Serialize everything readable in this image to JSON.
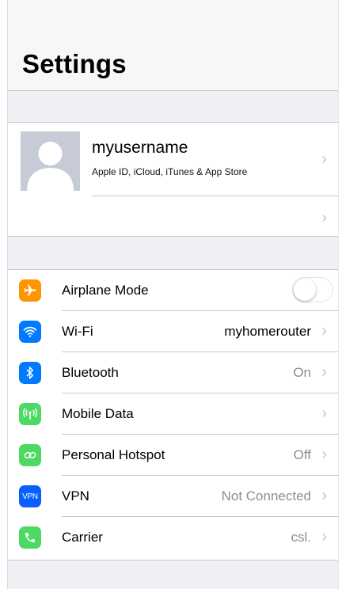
{
  "header": {
    "title": "Settings"
  },
  "profile": {
    "name": "myusername",
    "subtitle": "Apple ID, iCloud, iTunes & App Store"
  },
  "settings": [
    {
      "label": "Airplane Mode",
      "icon": "airplane-icon",
      "color": "#ff9500",
      "value": "",
      "toggle": false
    },
    {
      "label": "Wi-Fi",
      "icon": "wifi-icon",
      "color": "#007aff",
      "value": "myhomerouter"
    },
    {
      "label": "Bluetooth",
      "icon": "bluetooth-icon",
      "color": "#007aff",
      "value": "On"
    },
    {
      "label": "Mobile Data",
      "icon": "antenna-icon",
      "color": "#4cd964",
      "value": ""
    },
    {
      "label": "Personal Hotspot",
      "icon": "hotspot-icon",
      "color": "#4cd964",
      "value": "Off"
    },
    {
      "label": "VPN",
      "icon": "vpn-icon",
      "color": "#0a60ff",
      "value": "Not Connected",
      "icon_text": "VPN"
    },
    {
      "label": "Carrier",
      "icon": "phone-icon",
      "color": "#4cd964",
      "value": "csl."
    }
  ],
  "chevron": "›"
}
